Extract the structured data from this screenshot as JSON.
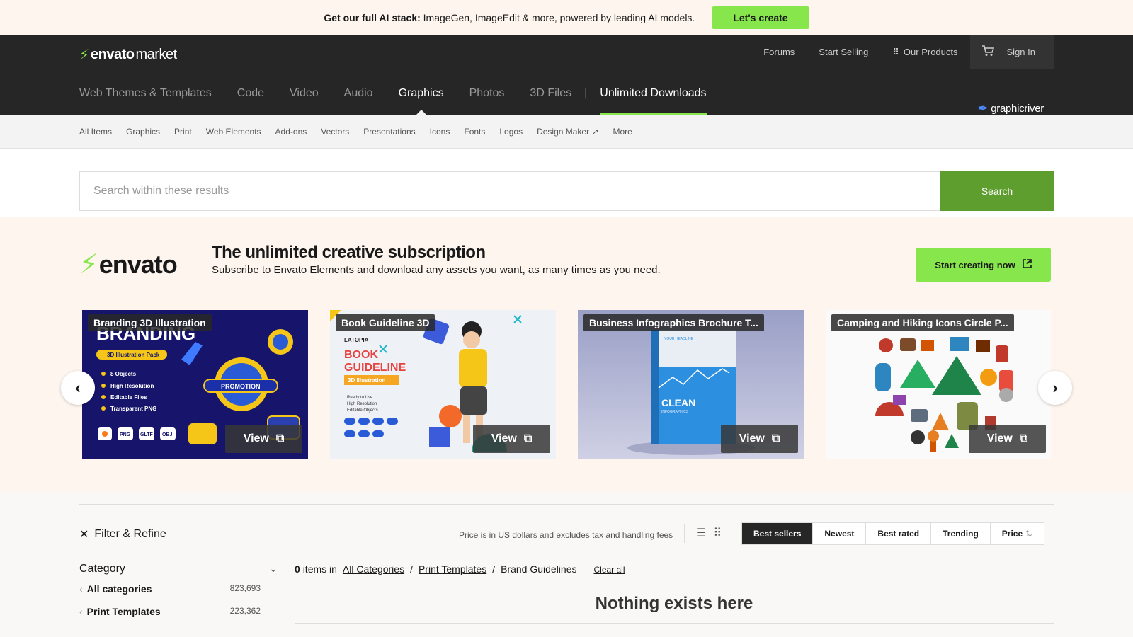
{
  "promo": {
    "lead": "Get our full AI stack:",
    "text": "ImageGen, ImageEdit & more, powered by leading AI models.",
    "cta": "Let's create"
  },
  "header": {
    "logo_brand": "envato",
    "logo_suffix": "market",
    "links": {
      "forums": "Forums",
      "start_selling": "Start Selling",
      "our_products": "Our Products",
      "sign_in": "Sign In"
    },
    "categories": [
      "Web Themes & Templates",
      "Code",
      "Video",
      "Audio",
      "Graphics",
      "Photos",
      "3D Files"
    ],
    "active_category": "Graphics",
    "unlimited": "Unlimited Downloads",
    "site_badge": "graphicriver"
  },
  "subnav": [
    "All Items",
    "Graphics",
    "Print",
    "Web Elements",
    "Add-ons",
    "Vectors",
    "Presentations",
    "Icons",
    "Fonts",
    "Logos",
    "Design Maker",
    "More"
  ],
  "search": {
    "placeholder": "Search within these results",
    "button": "Search"
  },
  "elements": {
    "logo": "envato",
    "headline": "The unlimited creative subscription",
    "subline": "Subscribe to Envato Elements and download any assets you want, as many times as you need.",
    "cta": "Start creating now",
    "cards": [
      {
        "title": "Branding 3D Illustration",
        "view": "View"
      },
      {
        "title": "Book Guideline 3D",
        "view": "View"
      },
      {
        "title": "Business Infographics Brochure T...",
        "view": "View"
      },
      {
        "title": "Camping and Hiking Icons Circle P...",
        "view": "View"
      }
    ],
    "card1_art": {
      "heading": "BRANDING",
      "pill": "3D Illustration Pack",
      "bullets": [
        "8 Objects",
        "High Resolution",
        "Editable Files",
        "Transparent PNG"
      ],
      "badge": "PROMOTION",
      "formats": [
        "PNG",
        "GLTF",
        "OBJ"
      ]
    },
    "card2_art": {
      "brand": "LATOPIA",
      "title1": "BOOK",
      "title2": "GUIDELINE",
      "pill": "3D Illustration",
      "bullets": [
        "Ready to Use",
        "High Resolution",
        "Editable Objects"
      ]
    },
    "card3_art": {
      "cover_top": "YOUR HEADLINE",
      "cover_title": "CLEAN",
      "cover_sub": "INFOGRAPHICS"
    }
  },
  "results": {
    "filter": "Filter & Refine",
    "price_note": "Price is in US dollars and excludes tax and handling fees",
    "sort": [
      "Best sellers",
      "Newest",
      "Best rated",
      "Trending",
      "Price"
    ],
    "active_sort": "Best sellers",
    "category_title": "Category",
    "count": "0",
    "items_in": "items in",
    "breadcrumbs": [
      "All Categories",
      "Print Templates",
      "Brand Guidelines"
    ],
    "clear_all": "Clear all",
    "category_rows": [
      {
        "name": "All categories",
        "count": "823,693"
      },
      {
        "name": "Print Templates",
        "count": "223,362"
      }
    ],
    "empty": "Nothing exists here"
  },
  "colors": {
    "accent": "#87e64b",
    "search_button": "#5e9e2f",
    "header_bg": "#262626"
  }
}
